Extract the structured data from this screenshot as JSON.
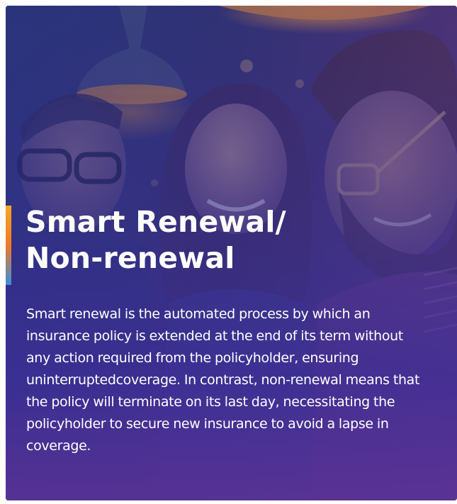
{
  "card": {
    "title_line1": "Smart Renewal/",
    "title_line2": "Non-renewal",
    "description": "Smart renewal is the automated process by which an insurance policy is extended at the end of its term without any action required from the policyholder, ensuring uninterruptedcoverage. In contrast, non-renewal means that the policy will terminate on its last day, necessitating the policyholder to secure new insurance to avoid a lapse in coverage.",
    "accent_colors": [
      "#f5a623",
      "#f0782a",
      "#3b8fd6"
    ],
    "overlay_color": "#3a2f7a"
  }
}
